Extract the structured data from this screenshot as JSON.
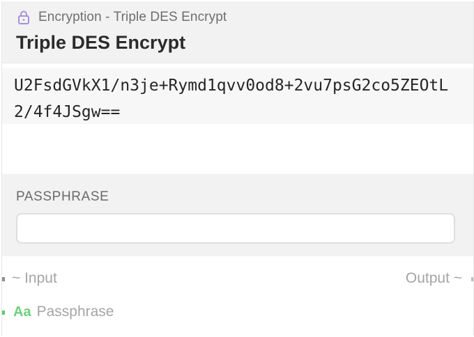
{
  "header": {
    "category": "Encryption - Triple DES Encrypt",
    "category_icon": "lock-icon",
    "title": "Triple DES Encrypt"
  },
  "output": {
    "value": "U2FsdGVkX1/n3je+Rymd1qvv0od8+2vu7psG2co5ZEOtL2/4f4JSgw=="
  },
  "params": {
    "passphrase_label": "PASSPHRASE",
    "passphrase_value": ""
  },
  "ports": {
    "input_label": "~ Input",
    "output_label": "Output ~",
    "passphrase_port_label": "Passphrase",
    "passphrase_port_icon": "Aa"
  },
  "colors": {
    "accent_lock": "#a792d6",
    "port_text_green": "#6fcf7f",
    "port_dot_green": "#5cc96c"
  }
}
